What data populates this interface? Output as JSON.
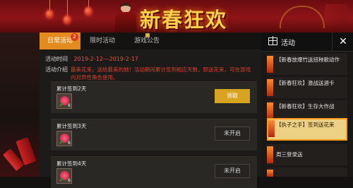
{
  "banner": {
    "title": "新春狂欢"
  },
  "tabs": [
    {
      "label": "日常活动",
      "badge": "2"
    },
    {
      "label": "限时活动"
    },
    {
      "label": "游戏公告"
    }
  ],
  "event": {
    "time_label": "活动时间",
    "time_value": "2019-2-12---2019-2-17",
    "intro_label": "活动介绍",
    "intro_text": "最美花束，送给最美的她！活动期间累计签到相应天数，即送花束，可在游戏内对异性角色使用。"
  },
  "cards": [
    {
      "title": "累计签到2天",
      "qty": "6",
      "button": "领取",
      "state": "claimable"
    },
    {
      "title": "累计签到3天",
      "qty": "6",
      "button": "未开启",
      "state": "locked"
    },
    {
      "title": "累计签到4天",
      "qty": "6",
      "button": "未开启",
      "state": "locked"
    }
  ],
  "sidebar": {
    "title": "活动",
    "close_glyph": "✕",
    "items": [
      {
        "label": "【新春放爆竹送扭秧歌动作"
      },
      {
        "label": "【新春狂欢】激战送週卡"
      },
      {
        "label": "【新春狂欢】生存大作战"
      },
      {
        "label": "【执子之手】签到送花束",
        "active": true
      },
      {
        "label": "周三登录送"
      }
    ]
  },
  "colors": {
    "accent": "#e58a1c",
    "claim": "#d7a320",
    "highlight": "#ecd184",
    "date": "#e2554a"
  }
}
